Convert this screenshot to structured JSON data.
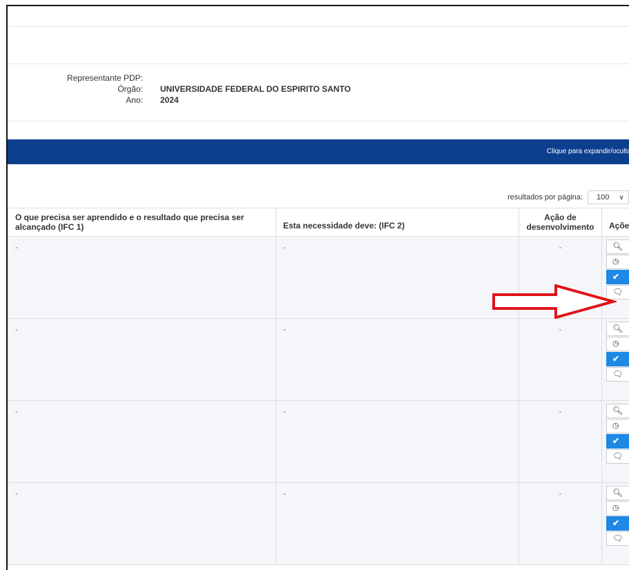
{
  "info": {
    "representante_label": "Representante PDP:",
    "orgao_label": "Órgão:",
    "orgao_value": "UNIVERSIDADE FEDERAL DO ESPIRITO SANTO",
    "ano_label": "Ano:",
    "ano_value": "2024"
  },
  "banner": {
    "link_text": "Clique para expandir/ocultar"
  },
  "pagination": {
    "label": "resultados por página:",
    "value": "100"
  },
  "table": {
    "headers": [
      "O que precisa ser aprendido e o resultado que precisa ser alcançado (IFC 1)",
      "Esta necessidade deve: (IFC 2)",
      "Ação de desenvolvimento",
      "Ações"
    ],
    "rows": [
      {
        "ifc1": "-",
        "ifc2": "-",
        "acao": "-"
      },
      {
        "ifc1": "-",
        "ifc2": "-",
        "acao": "-"
      },
      {
        "ifc1": "-",
        "ifc2": "-",
        "acao": "-"
      },
      {
        "ifc1": "-",
        "ifc2": "-",
        "acao": "-"
      }
    ]
  },
  "icons": {
    "view": "search-icon",
    "history": "clock-icon",
    "approve": "check-icon",
    "comment": "comment-icon"
  },
  "colors": {
    "banner": "#0d3f8f",
    "primary_button": "#1e88e5",
    "annotation_arrow": "#e0121b"
  }
}
